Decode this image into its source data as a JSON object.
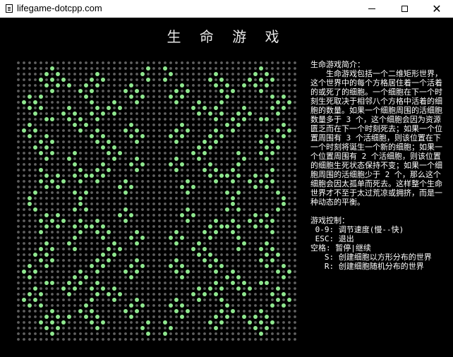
{
  "window": {
    "title": "lifegame-dotcpp.com"
  },
  "heading": "生 命 游 戏",
  "grid": {
    "rows": 50,
    "cols": 50,
    "dead_color": "#606060",
    "live_color": "#90e890",
    "background": "#000000"
  },
  "intro": {
    "title": "生命游戏简介：",
    "body": "生命游戏包括一个二维矩形世界，这个世界中的每个方格居住着一个活着的或死了的细胞。一个细胞在下一个时刻生死取决于相邻八个方格中活着的细胞的数量。如果一个细胞周围的活细胞数量多于 3 个，这个细胞会因为资源匮乏而在下一个时刻死去；如果一个位置周围有 3 个活细胞，则该位置在下一个时刻将诞生一个新的细胞；如果一个位置周围有 2 个活细胞，则该位置的细胞生死状态保持不变；如果一个细胞周围的活细胞少于 2 个，那么这个细胞会因太孤单而死去。这样整个生命世界才不至于太过荒凉或拥挤，而是一种动态的平衡。"
  },
  "controls": {
    "title": "游戏控制：",
    "lines": [
      " 0-9: 调节速度(慢--快)",
      " ESC: 退出",
      "空格: 暂停|继续",
      "   S: 创建细胞以方形分布的世界",
      "   R: 创建细胞随机分布的世界"
    ]
  }
}
